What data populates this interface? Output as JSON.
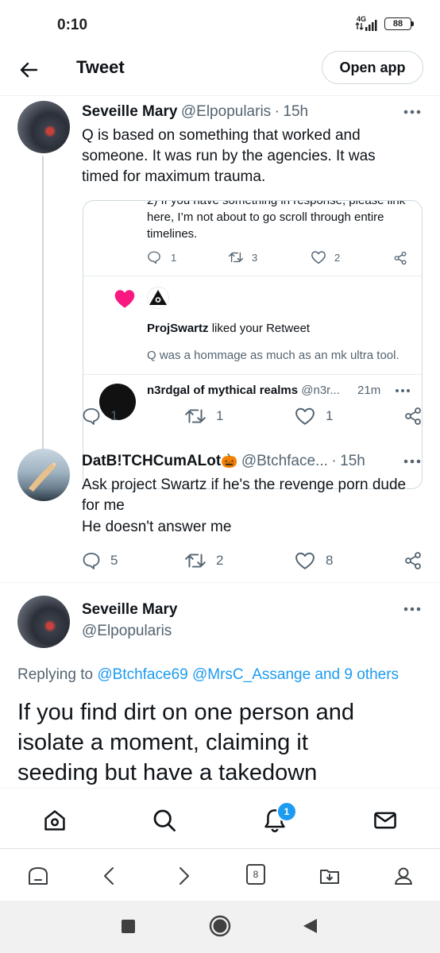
{
  "status_bar": {
    "time": "0:10",
    "network": "4G",
    "battery": "88"
  },
  "header": {
    "title": "Tweet",
    "open_app_label": "Open app"
  },
  "reply1": {
    "name": "Seveille Mary",
    "handle": "@Elpopularis",
    "sep": "·",
    "time": "15h",
    "text": "Q is based on something that worked and someone. It was run by the agencies.  It was timed for maximum trauma.",
    "embed": {
      "cutoff_line": "2) If you have something in response, please link",
      "text_lines": [
        "here, I’m not about to go scroll through entire",
        "timelines."
      ],
      "replies": "1",
      "retweets": "3",
      "likes": "2",
      "notif_user": "ProjSwartz",
      "notif_action": " liked your Retweet",
      "notif_tweet": "Q was a hommage as much as an mk ultra tool.",
      "cut_item_name": "n3rdgal of mythical realms",
      "cut_item_handle": "@n3r...",
      "cut_item_time": "21m"
    },
    "replies": "1",
    "retweets": "1",
    "likes": "1"
  },
  "reply2": {
    "name": "DatB!TCHCumALot",
    "handle": "@Btchface...",
    "sep": "·",
    "time": "15h",
    "emoji": "🎃",
    "text_line1": "Ask project Swartz if he's the revenge porn dude",
    "text_line2": "for me",
    "text_line3": "He doesn't answer me",
    "replies": "5",
    "retweets": "2",
    "likes": "8"
  },
  "main_tweet": {
    "name": "Seveille Mary",
    "handle": "@Elpopularis",
    "replying_prefix": "Replying to",
    "replying_to": "@Btchface69 @MrsC_Assange and 9 others",
    "text_line1": "If you find dirt on one person and",
    "text_line2": "isolate a moment, claiming it",
    "text_line3": "seeding but have a takedown"
  },
  "tabbar": {
    "notifications_badge": "1"
  },
  "browser_bar": {
    "tabs_count": "8"
  },
  "colors": {
    "accent": "#1d9bf0",
    "like_pink": "#f91880",
    "text": "#0f1419",
    "secondary": "#536471"
  }
}
